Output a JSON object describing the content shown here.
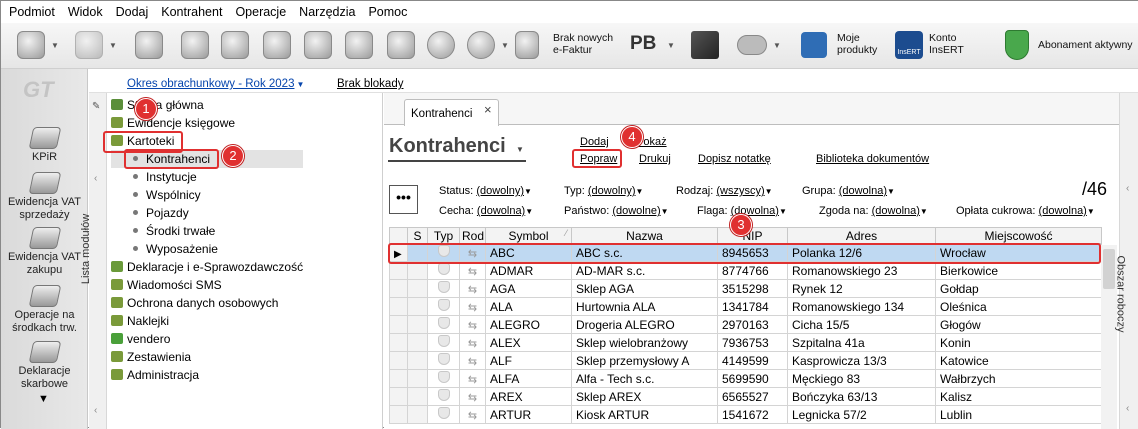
{
  "menu": [
    "Podmiot",
    "Widok",
    "Dodaj",
    "Kontrahent",
    "Operacje",
    "Narzędzia",
    "Pomoc"
  ],
  "toolbar": {
    "efaktur": "Brak nowych\ne-Faktur",
    "pb": "PB",
    "moje_produkty": "Moje\nprodukty",
    "konto_insert": "Konto\nInsERT",
    "abonament": "Abonament aktywny",
    "insert_logo": "InsERT"
  },
  "left_nav": {
    "logo": "GT",
    "items": [
      "KPiR",
      "Ewidencja VAT sprzedaży",
      "Ewidencja VAT zakupu",
      "Operacje na środkach trw.",
      "Deklaracje skarbowe"
    ]
  },
  "period": {
    "label": "Okres obrachunkowy - Rok 2023",
    "blokady": "Brak blokady"
  },
  "module_panel": {
    "vertical_label": "Lista modułów",
    "tree": [
      {
        "label": "Strona główna",
        "level": 0,
        "color": "#5a8e3a"
      },
      {
        "label": "Ewidencje księgowe",
        "level": 0,
        "color": "#7a9a3a"
      },
      {
        "label": "Kartoteki",
        "level": 0,
        "color": "#7a9a3a"
      },
      {
        "label": "Kontrahenci",
        "level": 1
      },
      {
        "label": "Instytucje",
        "level": 1
      },
      {
        "label": "Wspólnicy",
        "level": 1
      },
      {
        "label": "Pojazdy",
        "level": 1
      },
      {
        "label": "Środki trwałe",
        "level": 1
      },
      {
        "label": "Wyposażenie",
        "level": 1
      },
      {
        "label": "Deklaracje i e-Sprawozdawczość",
        "level": 0,
        "color": "#6a9a3a"
      },
      {
        "label": "Wiadomości SMS",
        "level": 0,
        "color": "#7a9a3a"
      },
      {
        "label": "Ochrona danych osobowych",
        "level": 0,
        "color": "#7a9a3a"
      },
      {
        "label": "Naklejki",
        "level": 0,
        "color": "#7a9a3a"
      },
      {
        "label": "vendero",
        "level": 0,
        "color": "#4aa03a"
      },
      {
        "label": "Zestawienia",
        "level": 0,
        "color": "#7a9a3a"
      },
      {
        "label": "Administracja",
        "level": 0,
        "color": "#7a9a3a"
      }
    ]
  },
  "badges": [
    "1",
    "2",
    "3",
    "4"
  ],
  "tab": {
    "label": "Kontrahenci",
    "close": "×"
  },
  "view": {
    "title": "Kontrahenci",
    "actions": {
      "dodaj": "Dodaj",
      "pokaz": "Pokaż",
      "popraw": "Popraw",
      "drukuj": "Drukuj",
      "dopisz": "Dopisz notatkę",
      "biblioteka": "Biblioteka dokumentów"
    },
    "count": "/46",
    "more": "•••"
  },
  "filters": {
    "status_label": "Status:",
    "status_value": "(dowolny)",
    "typ_label": "Typ:",
    "typ_value": "(dowolny)",
    "rodzaj_label": "Rodzaj:",
    "rodzaj_value": "(wszyscy)",
    "grupa_label": "Grupa:",
    "grupa_value": "(dowolna)",
    "cecha_label": "Cecha:",
    "cecha_value": "(dowolna)",
    "panstwo_label": "Państwo:",
    "panstwo_value": "(dowolne)",
    "flaga_label": "Flaga:",
    "flaga_value": "(dowolna)",
    "zgoda_label": "Zgoda na:",
    "zgoda_value": "(dowolna)",
    "oplata_label": "Opłata cukrowa:",
    "oplata_value": "(dowolna)"
  },
  "grid": {
    "columns": [
      "S",
      "Typ",
      "Rod",
      "Symbol",
      "Nazwa",
      "NIP",
      "Adres",
      "Miejscowość"
    ],
    "rows": [
      [
        "ABC",
        "ABC s.c.",
        "8945653",
        "Polanka  12/6",
        "Wrocław"
      ],
      [
        "ADMAR",
        "AD-MAR s.c.",
        "8774766",
        "Romanowskiego 23",
        "Bierkowice"
      ],
      [
        "AGA",
        "Sklep AGA",
        "3515298",
        "Rynek 12",
        "Gołdap"
      ],
      [
        "ALA",
        "Hurtownia ALA",
        "1341784",
        "Romanowskiego 134",
        "Oleśnica"
      ],
      [
        "ALEGRO",
        "Drogeria ALEGRO",
        "2970163",
        "Cicha  15/5",
        "Głogów"
      ],
      [
        "ALEX",
        "Sklep wielobranżowy",
        "7936753",
        "Szpitalna  41a",
        "Konin"
      ],
      [
        "ALF",
        "Sklep przemysłowy A",
        "4149599",
        "Kasprowicza  13/3",
        "Katowice"
      ],
      [
        "ALFA",
        "Alfa - Tech s.c.",
        "5699590",
        "Męckiego  83",
        "Wałbrzych"
      ],
      [
        "AREX",
        "Sklep AREX",
        "6565527",
        "Bończyka  63/13",
        "Kalisz"
      ],
      [
        "ARTUR",
        "Kiosk ARTUR",
        "1541672",
        "Legnicka  57/2",
        "Lublin"
      ]
    ]
  },
  "right_panel": {
    "vertical_label": "Obszar roboczy"
  }
}
